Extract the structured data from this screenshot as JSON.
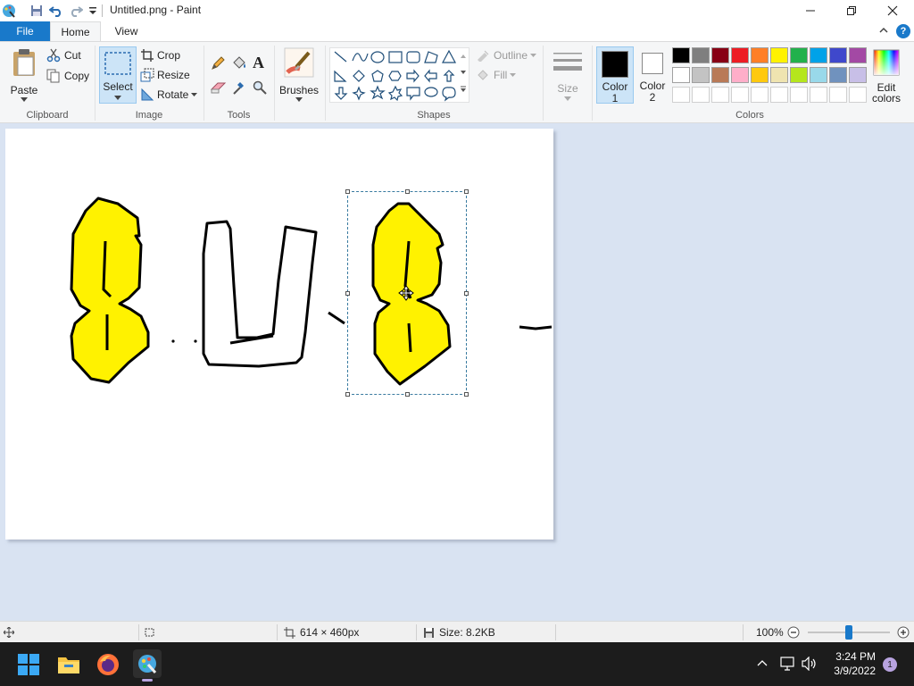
{
  "window": {
    "title": "Untitled.png - Paint"
  },
  "menu": {
    "tabs": [
      {
        "label": "File"
      },
      {
        "label": "Home"
      },
      {
        "label": "View"
      }
    ],
    "help": "?"
  },
  "ribbon": {
    "clipboard": {
      "group_label": "Clipboard",
      "paste": "Paste",
      "cut": "Cut",
      "copy": "Copy"
    },
    "image": {
      "group_label": "Image",
      "select": "Select",
      "crop": "Crop",
      "resize": "Resize",
      "rotate": "Rotate"
    },
    "tools": {
      "group_label": "Tools"
    },
    "brushes": {
      "label": "Brushes"
    },
    "shapes": {
      "group_label": "Shapes",
      "outline": "Outline",
      "fill": "Fill"
    },
    "size": {
      "label": "Size"
    },
    "colors": {
      "group_label": "Colors",
      "color1_a": "Color",
      "color1_b": "1",
      "color2_a": "Color",
      "color2_b": "2",
      "edit_a": "Edit",
      "edit_b": "colors",
      "color1_value": "#000000",
      "color2_value": "#ffffff",
      "palette_row1": [
        "#000000",
        "#7f7f7f",
        "#880015",
        "#ed1c24",
        "#ff7f27",
        "#fff200",
        "#22b14c",
        "#00a2e8",
        "#3f48cc",
        "#a349a4"
      ],
      "palette_row2": [
        "#ffffff",
        "#c3c3c3",
        "#b97a57",
        "#ffaec9",
        "#ffc90e",
        "#efe4b0",
        "#b5e61d",
        "#99d9ea",
        "#7092be",
        "#c8bfe7"
      ]
    }
  },
  "status": {
    "dimensions": "614 × 460px",
    "size": "Size: 8.2KB",
    "zoom": "100%",
    "zoom_level": 0.5
  },
  "taskbar": {
    "time": "3:24 PM",
    "date": "3/9/2022",
    "notifications": "1"
  }
}
